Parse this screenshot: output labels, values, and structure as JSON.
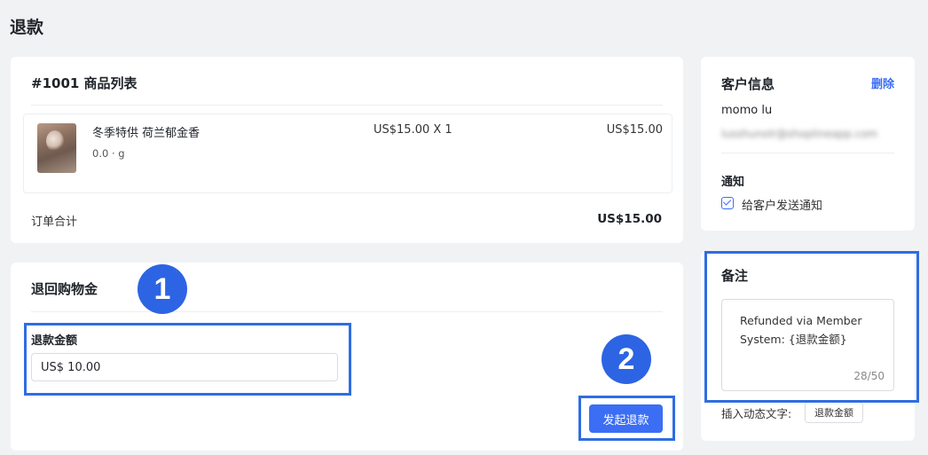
{
  "page": {
    "title": "退款"
  },
  "order": {
    "title": "#1001  商品列表",
    "item": {
      "name": "冬季特供 荷兰郁金香",
      "spec": "0.0 · g",
      "qty": "US$15.00 X 1",
      "price": "US$15.00"
    },
    "total_label": "订单合计",
    "total_value": "US$15.00"
  },
  "refund": {
    "title": "退回购物金",
    "amount_label": "退款金额",
    "amount_value": "US$ 10.00",
    "submit_label": "发起退款"
  },
  "customer": {
    "title": "客户信息",
    "delete_label": "删除",
    "name": "momo lu",
    "email": "lusshunolr@shoplineapp.com",
    "notify_title": "通知",
    "notify_label": "给客户发送通知",
    "notify_checked": true
  },
  "remark": {
    "title": "备注",
    "text": "Refunded via Member System: {退款金额}",
    "count": "28/50",
    "insert_label": "插入动态文字:",
    "insert_tag": "退款金额"
  },
  "annotations": {
    "step1": "1",
    "step2": "2",
    "color": "#2f6de1"
  },
  "colors": {
    "accent": "#3b6ef5",
    "background": "#f1f2f4"
  }
}
